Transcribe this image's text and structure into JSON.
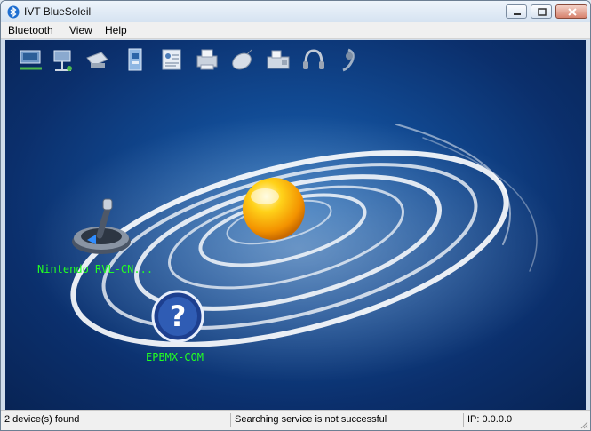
{
  "window": {
    "title": "IVT BlueSoleil"
  },
  "menu": [
    "Bluetooth",
    "View",
    "Help"
  ],
  "toolbar": [
    {
      "name": "network-access-icon"
    },
    {
      "name": "dial-up-icon"
    },
    {
      "name": "printer-icon"
    },
    {
      "name": "file-transfer-icon"
    },
    {
      "name": "pim-sync-icon"
    },
    {
      "name": "fax-printer-icon"
    },
    {
      "name": "mouse-icon"
    },
    {
      "name": "fax-icon"
    },
    {
      "name": "headphones-icon"
    },
    {
      "name": "headset-icon"
    }
  ],
  "devices": [
    {
      "name": "Nintendo RVL-CN...",
      "icon": "joystick-icon"
    },
    {
      "name": "EPBMX-COM",
      "icon": "unknown-device-icon"
    }
  ],
  "status": {
    "devices_found": "2 device(s) found",
    "message": "Searching service is not successful",
    "ip": "IP: 0.0.0.0"
  },
  "colors": {
    "device_label": "#22ff22",
    "background": "#0b2f6c"
  }
}
